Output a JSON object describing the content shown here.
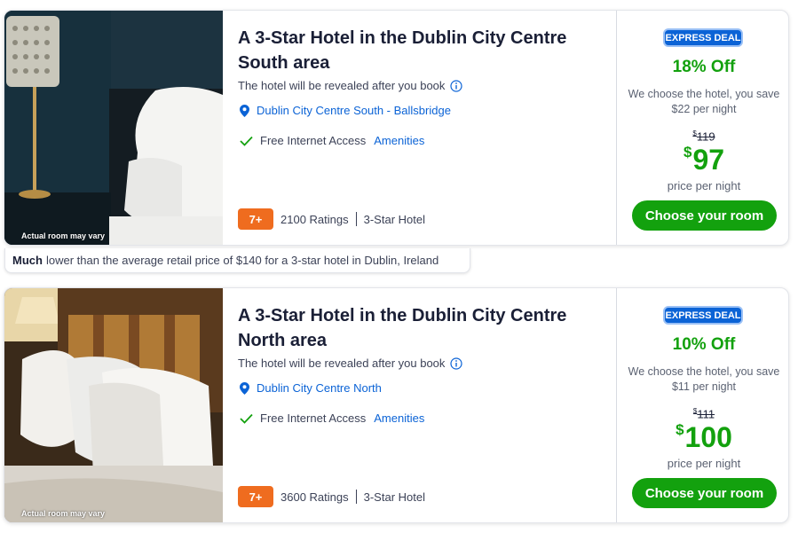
{
  "colors": {
    "accent_blue": "#0b63d6",
    "deal_green": "#13a10e",
    "rating_orange": "#ef6c1f"
  },
  "hotels": [
    {
      "caption": "Actual room may vary",
      "title": "A 3-Star Hotel in the Dublin City Centre South area",
      "reveal_text": "The hotel will be revealed after you book",
      "location": "Dublin City Centre South - Ballsbridge",
      "amenity": "Free Internet Access",
      "amenities_link": "Amenities",
      "rating_badge": "7+",
      "ratings": "2100 Ratings",
      "star_class": "3-Star Hotel",
      "deal_badge": "EXPRESS DEAL",
      "discount": "18% Off",
      "choose_text": "We choose the hotel, you save $22 per night",
      "original_price_symbol": "$",
      "original_price": "119",
      "price_symbol": "$",
      "price": "97",
      "price_label": "price per night",
      "cta": "Choose your room"
    },
    {
      "caption": "Actual room may vary",
      "title": "A 3-Star Hotel in the Dublin City Centre North area",
      "reveal_text": "The hotel will be revealed after you book",
      "location": "Dublin City Centre North",
      "amenity": "Free Internet Access",
      "amenities_link": "Amenities",
      "rating_badge": "7+",
      "ratings": "3600 Ratings",
      "star_class": "3-Star Hotel",
      "deal_badge": "EXPRESS DEAL",
      "discount": "10% Off",
      "choose_text": "We choose the hotel, you save $11 per night",
      "original_price_symbol": "$",
      "original_price": "111",
      "price_symbol": "$",
      "price": "100",
      "price_label": "price per night",
      "cta": "Choose your room"
    }
  ],
  "retail_note": {
    "emphasis": "Much",
    "text": "lower than the average retail price of $140 for a 3-star hotel in Dublin, Ireland"
  }
}
